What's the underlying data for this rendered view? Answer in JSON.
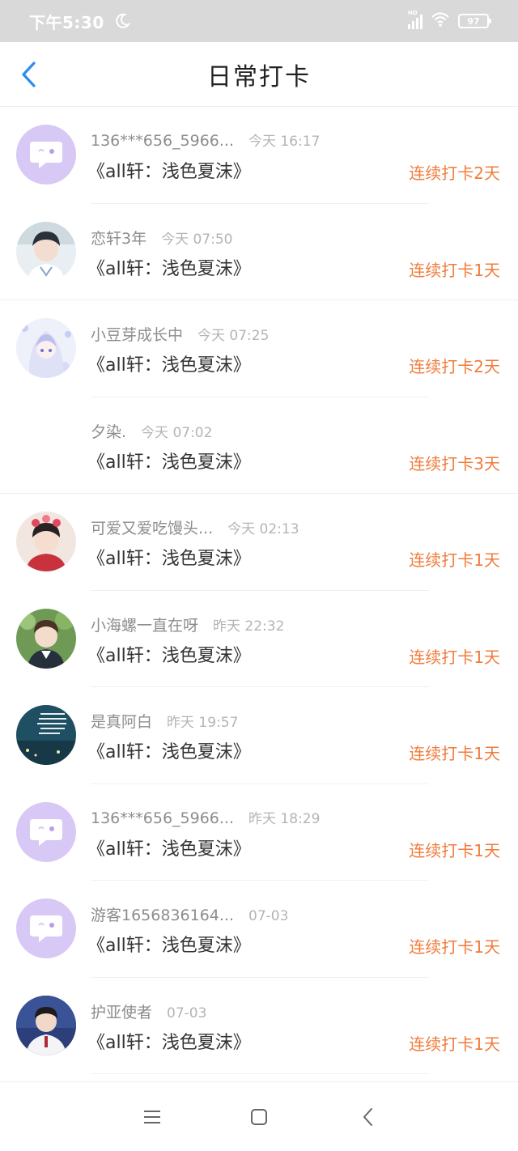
{
  "status_bar": {
    "time": "下午5:30",
    "network": "HD",
    "battery": "97"
  },
  "header": {
    "title": "日常打卡"
  },
  "items": [
    {
      "name": "136***656_5966...",
      "time": "今天 16:17",
      "book": "《all轩：浅色夏沫》",
      "streak": "连续打卡2天",
      "avatar": "default"
    },
    {
      "name": "恋轩3年",
      "time": "今天 07:50",
      "book": "《all轩：浅色夏沫》",
      "streak": "连续打卡1天",
      "avatar": "photo-boy-light"
    },
    {
      "name": "小豆芽成长中",
      "time": "今天 07:25",
      "book": "《all轩：浅色夏沫》",
      "streak": "连续打卡2天",
      "avatar": "anime-girl"
    },
    {
      "name": "夕染.",
      "time": "今天 07:02",
      "book": "《all轩：浅色夏沫》",
      "streak": "连续打卡3天",
      "avatar": "none"
    },
    {
      "name": "可爱又爱吃馒头...",
      "time": "今天 02:13",
      "book": "《all轩：浅色夏沫》",
      "streak": "连续打卡1天",
      "avatar": "photo-flower"
    },
    {
      "name": "小海螺一直在呀",
      "time": "昨天 22:32",
      "book": "《all轩：浅色夏沫》",
      "streak": "连续打卡1天",
      "avatar": "photo-boy-green"
    },
    {
      "name": "是真阿白",
      "time": "昨天 19:57",
      "book": "《all轩：浅色夏沫》",
      "streak": "连续打卡1天",
      "avatar": "photo-text-blue"
    },
    {
      "name": "136***656_5966...",
      "time": "昨天 18:29",
      "book": "《all轩：浅色夏沫》",
      "streak": "连续打卡1天",
      "avatar": "default"
    },
    {
      "name": "游客1656836164...",
      "time": "07-03",
      "book": "《all轩：浅色夏沫》",
      "streak": "连续打卡1天",
      "avatar": "default"
    },
    {
      "name": "护亚使者",
      "time": "07-03",
      "book": "《all轩：浅色夏沫》",
      "streak": "连续打卡1天",
      "avatar": "photo-boy-blue"
    }
  ],
  "colors": {
    "accent": "#2d8cf0",
    "streak": "#f07c3c",
    "default_avatar": "#d8c8f5"
  }
}
